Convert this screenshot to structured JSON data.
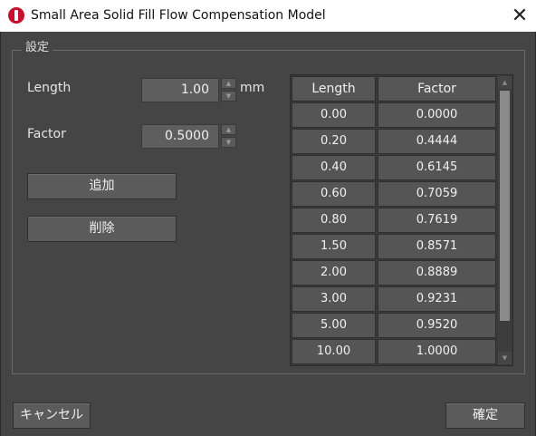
{
  "window": {
    "title": "Small Area Solid Fill Flow Compensation Model",
    "icon": "app-logo-icon",
    "close_glyph": "✕"
  },
  "group": {
    "label": "設定"
  },
  "length": {
    "label": "Length",
    "value": "1.00",
    "unit": "mm"
  },
  "factor": {
    "label": "Factor",
    "value": "0.5000"
  },
  "spinner": {
    "up": "▲",
    "down": "▼"
  },
  "buttons": {
    "add": "追加",
    "delete": "削除",
    "cancel": "キャンセル",
    "ok": "確定"
  },
  "table": {
    "headers": [
      "Length",
      "Factor"
    ],
    "rows": [
      [
        "0.00",
        "0.0000"
      ],
      [
        "0.20",
        "0.4444"
      ],
      [
        "0.40",
        "0.6145"
      ],
      [
        "0.60",
        "0.7059"
      ],
      [
        "0.80",
        "0.7619"
      ],
      [
        "1.50",
        "0.8571"
      ],
      [
        "2.00",
        "0.8889"
      ],
      [
        "3.00",
        "0.9231"
      ],
      [
        "5.00",
        "0.9520"
      ],
      [
        "10.00",
        "1.0000"
      ]
    ]
  },
  "colors": {
    "background": "#454545",
    "titlebar": "#ffffff",
    "app_icon": "#c8102e"
  }
}
